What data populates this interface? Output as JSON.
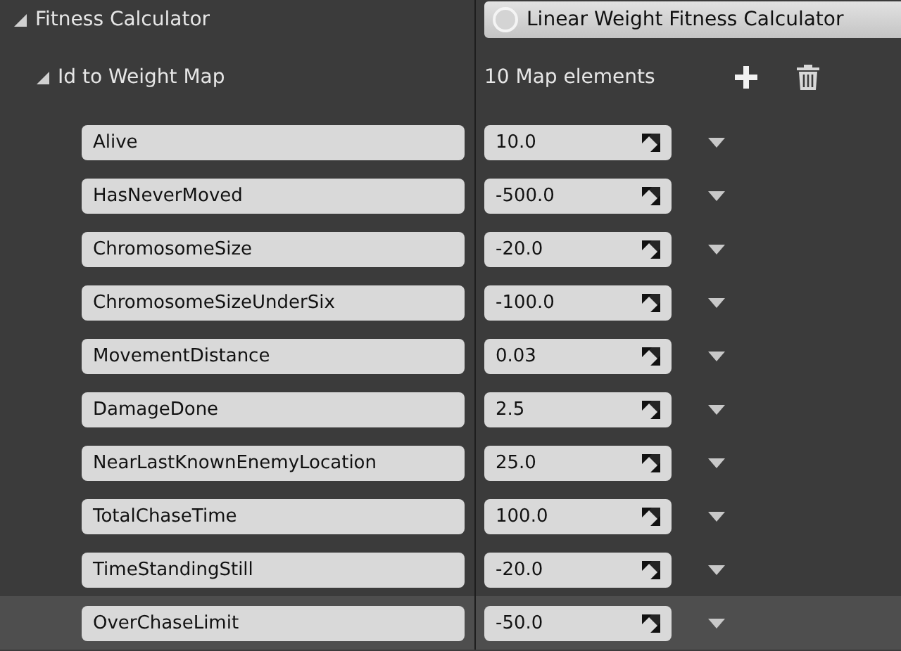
{
  "category": {
    "label": "Fitness Calculator",
    "expanded": true,
    "value": "Linear Weight Fitness Calculator"
  },
  "map": {
    "label": "Id to Weight Map",
    "expanded": true,
    "count": "10 Map elements"
  },
  "entries": [
    {
      "key": "Alive",
      "value": "10.0",
      "highlighted": false
    },
    {
      "key": "HasNeverMoved",
      "value": "-500.0",
      "highlighted": false
    },
    {
      "key": "ChromosomeSize",
      "value": "-20.0",
      "highlighted": false
    },
    {
      "key": "ChromosomeSizeUnderSix",
      "value": "-100.0",
      "highlighted": false
    },
    {
      "key": "MovementDistance",
      "value": "0.03",
      "highlighted": false
    },
    {
      "key": "DamageDone",
      "value": "2.5",
      "highlighted": false
    },
    {
      "key": "NearLastKnownEnemyLocation",
      "value": "25.0",
      "highlighted": false
    },
    {
      "key": "TotalChaseTime",
      "value": "100.0",
      "highlighted": false
    },
    {
      "key": "TimeStandingStill",
      "value": "-20.0",
      "highlighted": false
    },
    {
      "key": "OverChaseLimit",
      "value": "-50.0",
      "highlighted": true
    }
  ]
}
